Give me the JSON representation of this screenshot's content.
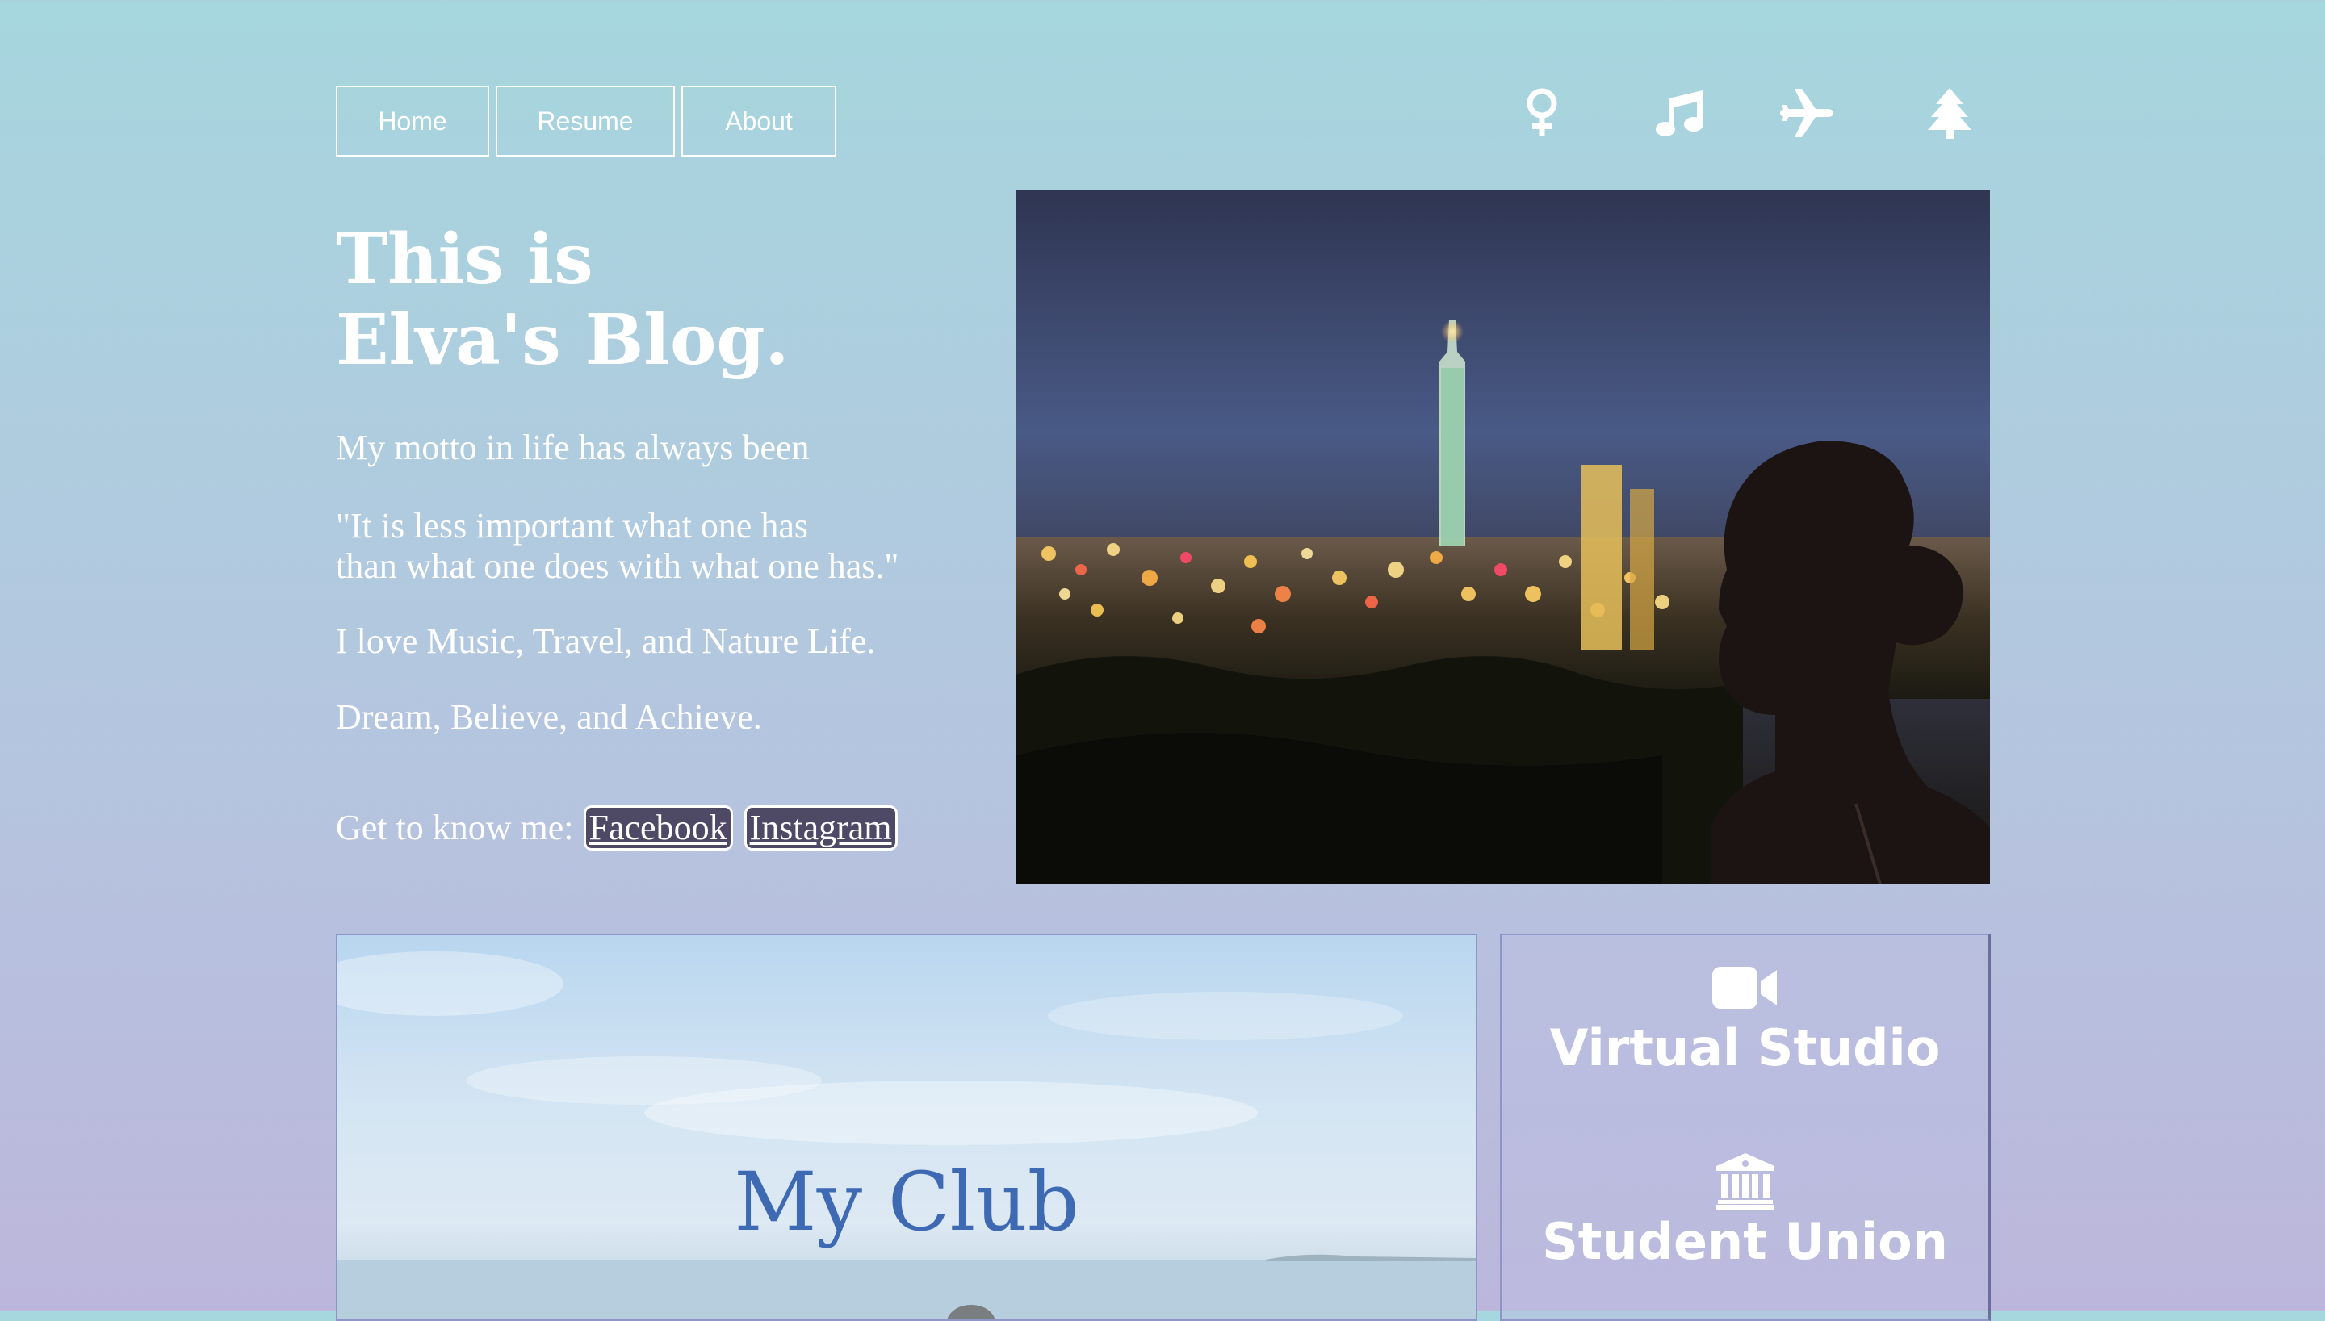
{
  "nav": {
    "items": [
      {
        "label": "Home"
      },
      {
        "label": "Resume"
      },
      {
        "label": "About"
      }
    ]
  },
  "top_icons": [
    "female-icon",
    "music-icon",
    "airplane-icon",
    "tree-icon"
  ],
  "hero": {
    "title_line1": "This is",
    "title_line2": "Elva's Blog.",
    "motto_intro": "My motto in life has always been",
    "quote_line1": "\"It is less important what one has",
    "quote_line2": "than what one does with what one has.\"",
    "loves": "I love Music, Travel, and Nature Life.",
    "dream": "Dream, Believe, and Achieve.",
    "social_label": "Get to know me:",
    "social_links": [
      "Facebook",
      "Instagram"
    ]
  },
  "club_card": {
    "title": "My Club"
  },
  "side_card": {
    "items": [
      {
        "label": "Virtual Studio",
        "icon": "video-camera-icon"
      },
      {
        "label": "Student Union",
        "icon": "building-columns-icon"
      }
    ]
  },
  "colors": {
    "background_top": "#a6d6de",
    "background_bottom": "#bcb6dc",
    "club_title": "#3e69b3",
    "social_button_bg": "#4e4a66",
    "text": "#ffffff"
  }
}
